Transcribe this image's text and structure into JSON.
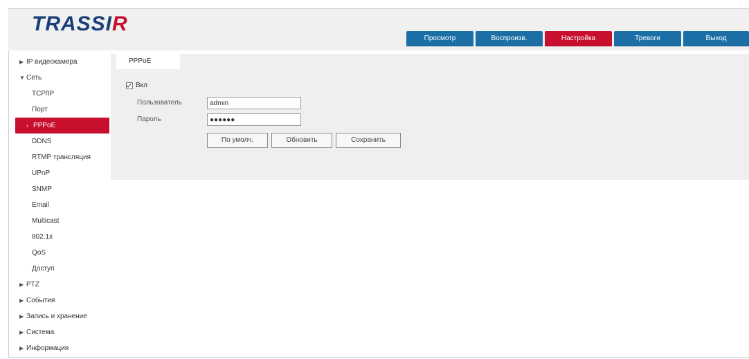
{
  "app": {
    "logo_text": "TRASSIR",
    "logo_main": "TRASSI",
    "logo_accent": "R"
  },
  "nav": {
    "items": [
      {
        "label": "Просмотр",
        "color": "#1c6fa6"
      },
      {
        "label": "Воспроизв.",
        "color": "#1c6fa6"
      },
      {
        "label": "Настройка",
        "color": "#c8102e",
        "active": true
      },
      {
        "label": "Тревоги",
        "color": "#1c6fa6"
      },
      {
        "label": "Выход",
        "color": "#1c6fa6"
      }
    ]
  },
  "sidebar": {
    "items": [
      {
        "label": "IP видеокамера",
        "expanded": false
      },
      {
        "label": "Сеть",
        "expanded": true
      },
      {
        "label": "TCP/IP"
      },
      {
        "label": "Порт"
      },
      {
        "label": "PPPoE",
        "active": true
      },
      {
        "label": "DDNS"
      },
      {
        "label": "RTMP трансляция"
      },
      {
        "label": "UPnP"
      },
      {
        "label": "SNMP"
      },
      {
        "label": "Email"
      },
      {
        "label": "Multicast"
      },
      {
        "label": "802.1x"
      },
      {
        "label": "QoS"
      },
      {
        "label": "Доступ"
      },
      {
        "label": "PTZ",
        "expanded": false
      },
      {
        "label": "События",
        "expanded": false
      },
      {
        "label": "Запись и хранение",
        "expanded": false
      },
      {
        "label": "Система",
        "expanded": false
      },
      {
        "label": "Информация",
        "expanded": false
      }
    ]
  },
  "content": {
    "tab": "PPPoE",
    "enable_label": "Вкл",
    "enable_checked": true,
    "fields": [
      {
        "label": "Пользователь",
        "value": "admin"
      },
      {
        "label": "Пароль",
        "value": "●●●●●●"
      }
    ],
    "buttons": {
      "default": "По умолч.",
      "refresh": "Обновить",
      "save": "Сохранить"
    }
  },
  "colors": {
    "brand_blue": "#1a3f78",
    "accent_red": "#c8102e",
    "nav_blue": "#1c6fa6",
    "panel_bg": "#efefef"
  }
}
